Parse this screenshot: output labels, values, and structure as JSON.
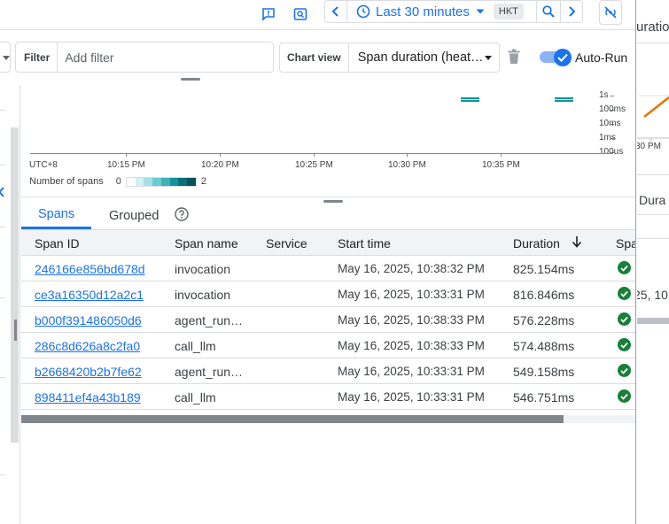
{
  "toolbar": {
    "time_range": "Last 30 minutes",
    "timezone": "HKT"
  },
  "filter": {
    "label": "Filter",
    "placeholder": "Add filter"
  },
  "chart_view": {
    "label": "Chart view",
    "value": "Span duration (heat…"
  },
  "auto_run": {
    "label": "Auto-Run",
    "checked": true
  },
  "chart": {
    "timezone_label": "UTC+8",
    "x_ticks": [
      "10:15 PM",
      "10:20 PM",
      "10:25 PM",
      "10:30 PM",
      "10:35 PM"
    ],
    "y_ticks": [
      "1s",
      "100ms",
      "10ms",
      "1ms",
      "100us"
    ],
    "legend_label": "Number of spans",
    "legend_min": "0",
    "legend_max": "2"
  },
  "chart_data": {
    "type": "heatmap",
    "x_ticks": [
      "10:15 PM",
      "10:20 PM",
      "10:25 PM",
      "10:30 PM",
      "10:35 PM"
    ],
    "y_ticks": [
      "1s",
      "100ms",
      "10ms",
      "1ms",
      "100us"
    ],
    "y_scale": "log",
    "cells": [
      {
        "time": "10:33 PM",
        "duration_range": "100ms-1s",
        "count": 2
      },
      {
        "time": "10:38 PM",
        "duration_range": "100ms-1s",
        "count": 2
      }
    ],
    "legend_title": "Number of spans",
    "color_range": [
      0,
      2
    ]
  },
  "tabs": [
    "Spans",
    "Grouped"
  ],
  "table": {
    "headers": [
      "Span ID",
      "Span name",
      "Service",
      "Start time",
      "Duration",
      "Spa"
    ],
    "rows": [
      {
        "id": "246166e856bd678d",
        "name": "invocation",
        "service": "",
        "start": "May 16, 2025, 10:38:32 PM",
        "duration": "825.154ms"
      },
      {
        "id": "ce3a16350d12a2c1",
        "name": "invocation",
        "service": "",
        "start": "May 16, 2025, 10:33:31 PM",
        "duration": "816.846ms"
      },
      {
        "id": "b000f391486050d6",
        "name": "agent_run…",
        "service": "",
        "start": "May 16, 2025, 10:38:33 PM",
        "duration": "576.228ms"
      },
      {
        "id": "286c8d626a8c2fa0",
        "name": "call_llm",
        "service": "",
        "start": "May 16, 2025, 10:38:33 PM",
        "duration": "574.488ms"
      },
      {
        "id": "b2668420b2b7fe62",
        "name": "agent_run…",
        "service": "",
        "start": "May 16, 2025, 10:33:31 PM",
        "duration": "549.158ms"
      },
      {
        "id": "898411ef4a43b189",
        "name": "call_llm",
        "service": "",
        "start": "May 16, 2025, 10:33:31 PM",
        "duration": "546.751ms"
      }
    ]
  },
  "background_window": {
    "title_fragment": "uratio",
    "axis_fragment": "30 PM",
    "column_fragment": "Dura",
    "date_fragment": "25, 10"
  },
  "colors": {
    "accent": "#1a73e8",
    "success": "#188038",
    "heat": "#12939a"
  }
}
